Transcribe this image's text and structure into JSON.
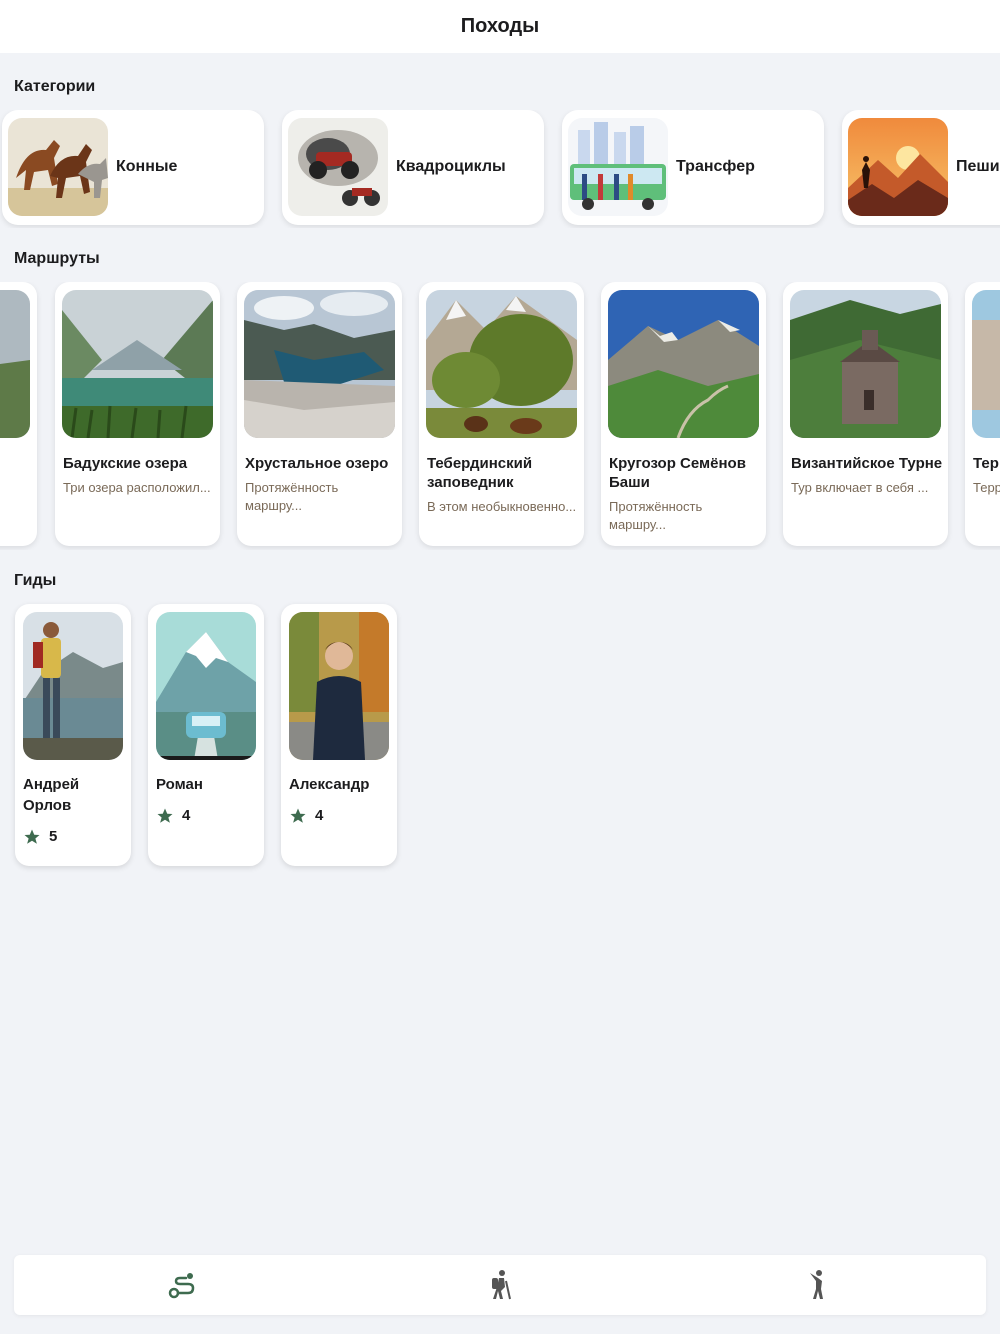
{
  "header": {
    "title": "Походы"
  },
  "sections": {
    "categories": "Категории",
    "routes": "Маршруты",
    "guides": "Гиды"
  },
  "categories": [
    {
      "label": "Конные",
      "icon": "horses-image"
    },
    {
      "label": "Квадроциклы",
      "icon": "atv-image"
    },
    {
      "label": "Трансфер",
      "icon": "bus-image"
    },
    {
      "label": "Пеши",
      "icon": "hiker-image"
    }
  ],
  "routes": [
    {
      "name": "",
      "desc": ""
    },
    {
      "name": "Бадукские озера",
      "desc": "Три озера расположил..."
    },
    {
      "name": "Хрустальное озеро",
      "desc": "Протяжённость маршру..."
    },
    {
      "name": "Тебердинский заповедник",
      "desc": "В этом необыкновенно..."
    },
    {
      "name": "Кругозор Семёнов Баши",
      "desc": "Протяжённость маршру..."
    },
    {
      "name": "Византийское Турне",
      "desc": "Тур включает в себя ..."
    },
    {
      "name": "Тер исто",
      "desc": "Терр исто"
    }
  ],
  "guides": [
    {
      "name": "Андрей Орлов",
      "rating": "5"
    },
    {
      "name": "Роман",
      "rating": "4"
    },
    {
      "name": "Александр",
      "rating": "4"
    }
  ],
  "tabs": [
    {
      "icon": "route-icon",
      "active": true
    },
    {
      "icon": "hiker-icon",
      "active": false
    },
    {
      "icon": "person-icon",
      "active": false
    }
  ],
  "colors": {
    "accent": "#3e6b4f",
    "inactive": "#555555",
    "desc": "#7a6a58",
    "background": "#f1f3f7"
  }
}
